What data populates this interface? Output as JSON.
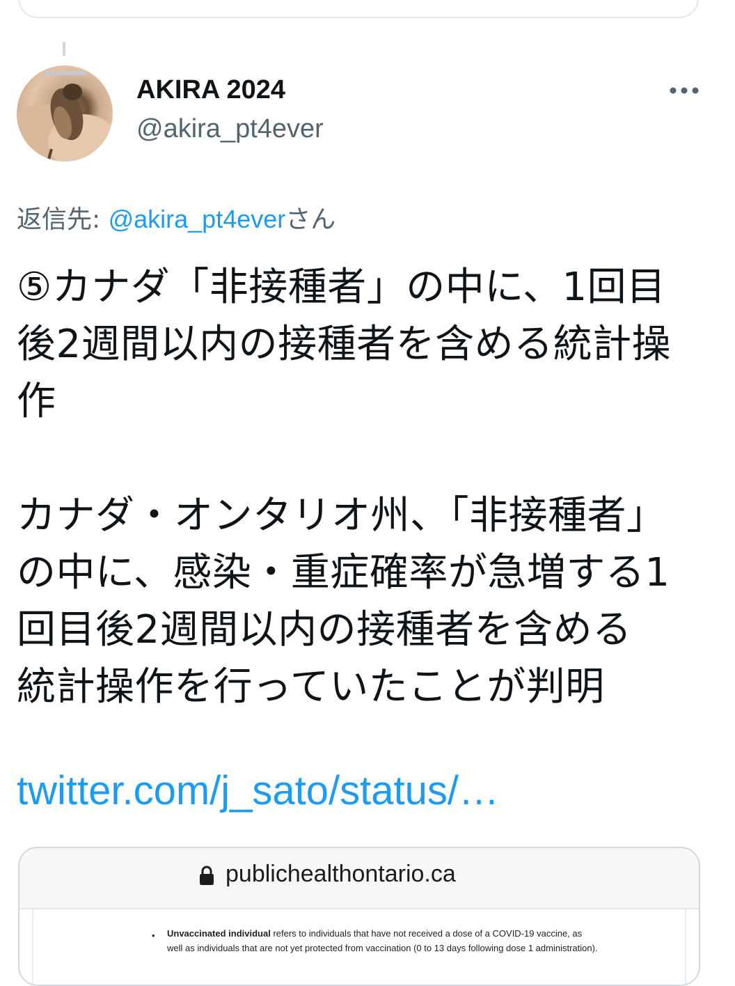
{
  "author": {
    "name": "AKIRA 2024",
    "handle": "@akira_pt4ever"
  },
  "reply": {
    "prefix": "返信先: ",
    "mention": "@akira_pt4ever",
    "suffix": "さん"
  },
  "tweet": {
    "paragraph1": "⑤カナダ「非接種者」の中に、1回目後2週間以内の接種者を含める統計操作",
    "paragraph2": "カナダ・オンタリオ州、「非接種者」の中に、感染・重症確率が急増する1回目後2週間以内の接種者を含める統計操作を行っていたことが判明",
    "link": "twitter.com/j_sato/status/…"
  },
  "media": {
    "url": "publichealthontario.ca",
    "bullet": "•",
    "term": "Unvaccinated individual",
    "definition": " refers to individuals that have not received a dose of a COVID-19 vaccine, as well as individuals that are not yet protected from vaccination (0 to 13 days following dose 1 administration)."
  },
  "icons": {
    "more": "more-horizontal-icon",
    "lock": "lock-icon"
  },
  "colors": {
    "link": "#1d9bf0",
    "secondary_text": "#536471",
    "primary_text": "#0f1419"
  }
}
